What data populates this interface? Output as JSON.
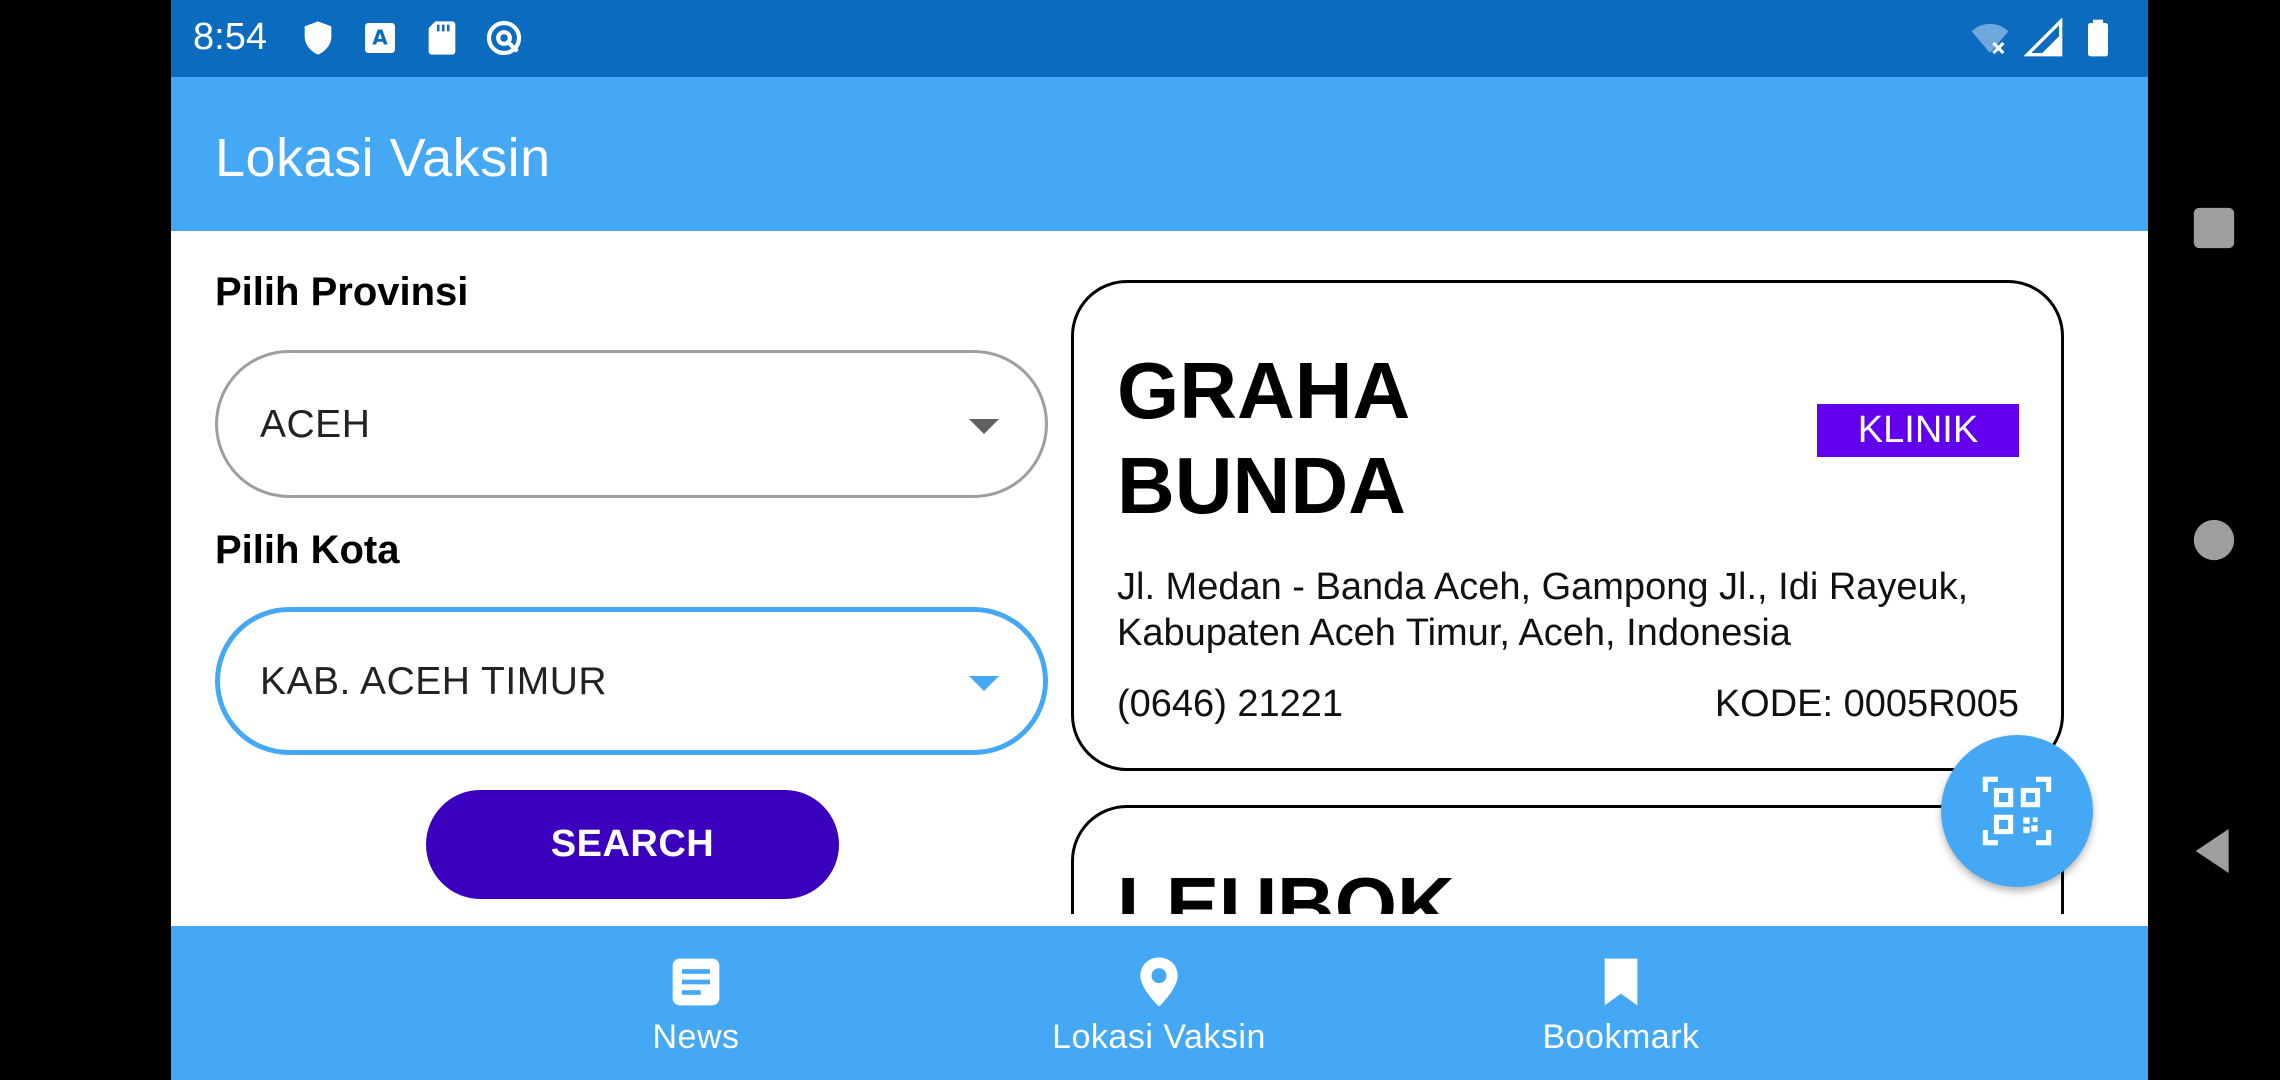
{
  "status_bar": {
    "time": "8:54",
    "left_icons": [
      "shield-icon",
      "a-letter-icon",
      "sd-card-icon",
      "at-sign-icon"
    ],
    "right_icons": [
      "wifi-off-icon",
      "signal-icon",
      "battery-icon"
    ]
  },
  "app_bar": {
    "title": "Lokasi Vaksin"
  },
  "form": {
    "provinsi_label": "Pilih Provinsi",
    "provinsi_value": "ACEH",
    "kota_label": "Pilih Kota",
    "kota_value": "KAB. ACEH TIMUR",
    "search_label": "SEARCH"
  },
  "locations": [
    {
      "name_line1": "GRAHA",
      "name_line2": "BUNDA",
      "type": "KLINIK",
      "address": "Jl. Medan - Banda Aceh, Gampong Jl., Idi Rayeuk, Kabupaten Aceh Timur, Aceh, Indonesia",
      "phone": "(0646) 21221",
      "code": "KODE: 0005R005"
    },
    {
      "name_line1": "LEUBOK"
    }
  ],
  "fab": {
    "icon": "qr-code-icon"
  },
  "bottom_nav": {
    "items": [
      {
        "label": "News",
        "icon": "news-icon"
      },
      {
        "label": "Lokasi Vaksin",
        "icon": "location-pin-icon"
      },
      {
        "label": "Bookmark",
        "icon": "bookmark-icon"
      }
    ]
  },
  "colors": {
    "status_bar": "#0a6bbf",
    "primary": "#45a8f4",
    "search_button": "#3b00bd",
    "badge": "#6200ee"
  }
}
